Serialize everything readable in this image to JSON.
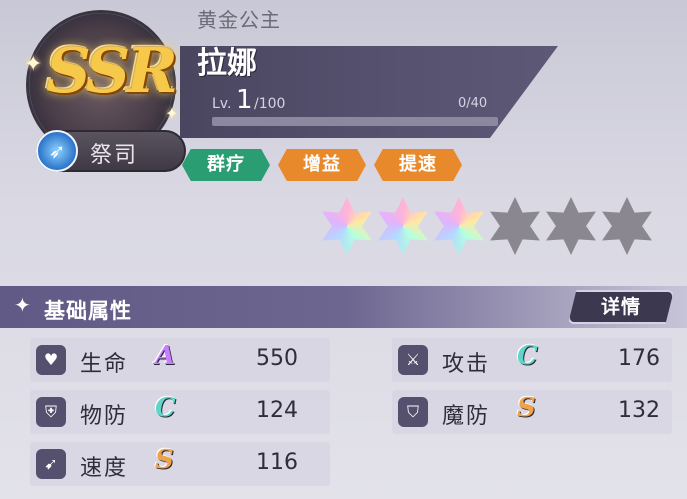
{
  "colors": {
    "ssr_gold": "#f6c94a",
    "tag_green": "#2a9d73",
    "tag_orange": "#e88a2c",
    "grade_A": "#c77dff",
    "grade_C": "#5fd6c8",
    "grade_S": "#f0a24a"
  },
  "character": {
    "rarity": "SSR",
    "class_icon": "running-figure-icon",
    "class_name": "祭司",
    "title": "黄金公主",
    "name": "拉娜",
    "level_prefix": "Lv.",
    "level": "1",
    "level_max": "/100",
    "exp_text": "0/40",
    "exp_progress": 0.0
  },
  "tags": [
    {
      "label": "群疗",
      "color": "green"
    },
    {
      "label": "增益",
      "color": "orange"
    },
    {
      "label": "提速",
      "color": "orange"
    }
  ],
  "stars": {
    "filled": 3,
    "total": 6
  },
  "attributes": {
    "section_title": "基础属性",
    "details_label": "详情",
    "stats": [
      {
        "icon": "heart-icon",
        "label": "生命",
        "grade": "A",
        "value": "550"
      },
      {
        "icon": "sword-icon",
        "label": "攻击",
        "grade": "C",
        "value": "176"
      },
      {
        "icon": "shield-icon",
        "label": "物防",
        "grade": "C",
        "value": "124"
      },
      {
        "icon": "magic-shield-icon",
        "label": "魔防",
        "grade": "S",
        "value": "132"
      },
      {
        "icon": "wing-icon",
        "label": "速度",
        "grade": "S",
        "value": "116"
      }
    ]
  }
}
